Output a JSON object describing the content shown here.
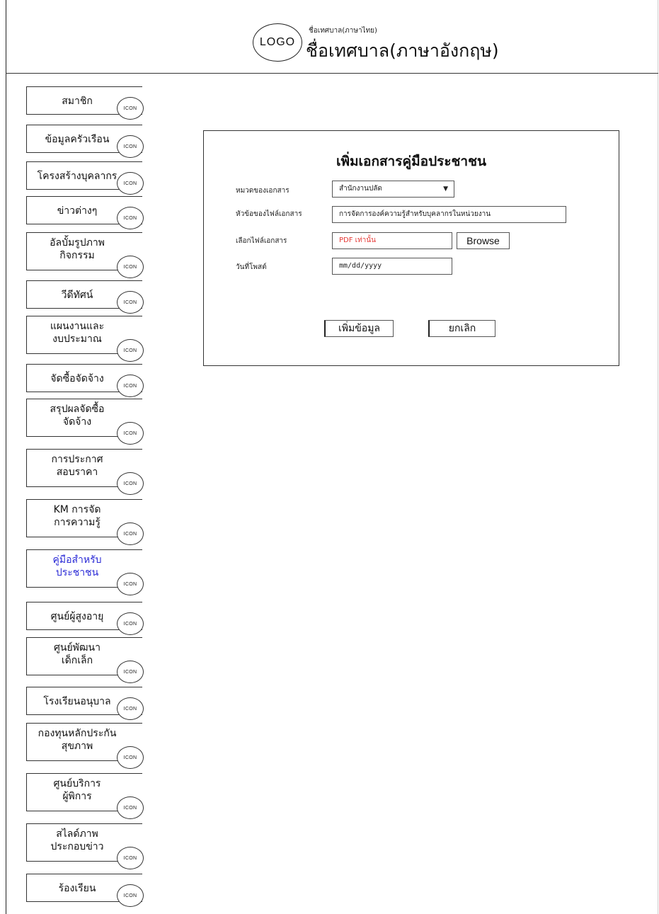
{
  "header": {
    "logo_text": "LOGO",
    "name_thai": "ชื่อเทศบาล(ภาษาไทย)",
    "name_english": "ชื่อเทศบาล(ภาษาอังกฤษ)"
  },
  "sidebar": {
    "icon_text": "ICON",
    "active_color": "#2b2bd6",
    "items": [
      {
        "label": "สมาชิก"
      },
      {
        "label": "ข้อมูลครัวเรือน"
      },
      {
        "label": "โครงสร้างบุคลากร"
      },
      {
        "label": "ข่าวต่างๆ"
      },
      {
        "label": "อัลบั้มรูปภาพ\nกิจกรรม"
      },
      {
        "label": "วีดีทัศน์"
      },
      {
        "label": "แผนงานและ\nงบประมาณ"
      },
      {
        "label": "จัดซื้อจัดจ้าง"
      },
      {
        "label": "สรุปผลจัดซื้อ\nจัดจ้าง"
      },
      {
        "label": "การประกาศ\nสอบราคา"
      },
      {
        "label": "KM การจัด\nการความรู้"
      },
      {
        "label": "คู่มือสำหรับ\nประชาชน",
        "active": true
      },
      {
        "label": "ศูนย์ผู้สูงอายุ"
      },
      {
        "label": "ศูนย์พัฒนา\nเด็กเล็ก"
      },
      {
        "label": "โรงเรียนอนุบาล"
      },
      {
        "label": "กองทุนหลักประกัน\nสุขภาพ"
      },
      {
        "label": "ศูนย์บริการ\nผู้พิการ"
      },
      {
        "label": "สไลด์ภาพ\nประกอบข่าว"
      },
      {
        "label": "ร้องเรียน"
      }
    ]
  },
  "form": {
    "title": "เพิ่มเอกสารคู่มือประชาชน",
    "category_label": "หมวดของเอกสาร",
    "category_value": "สำนักงานปลัด",
    "filename_label": "หัวข้อของไฟล์เอกสาร",
    "filename_value": "การจัดการองค์ความรู้สำหรับบุคลากรในหน่วยงาน",
    "file_label": "เลือกไฟล์เอกสาร",
    "file_placeholder": "PDF เท่านั้น",
    "file_placeholder_color": "#e53935",
    "browse_label": "Browse",
    "date_label": "วันที่โพสต์",
    "date_value": "mm/dd/yyyy",
    "submit_label": "เพิ่มข้อมูล",
    "cancel_label": "ยกเลิก"
  }
}
